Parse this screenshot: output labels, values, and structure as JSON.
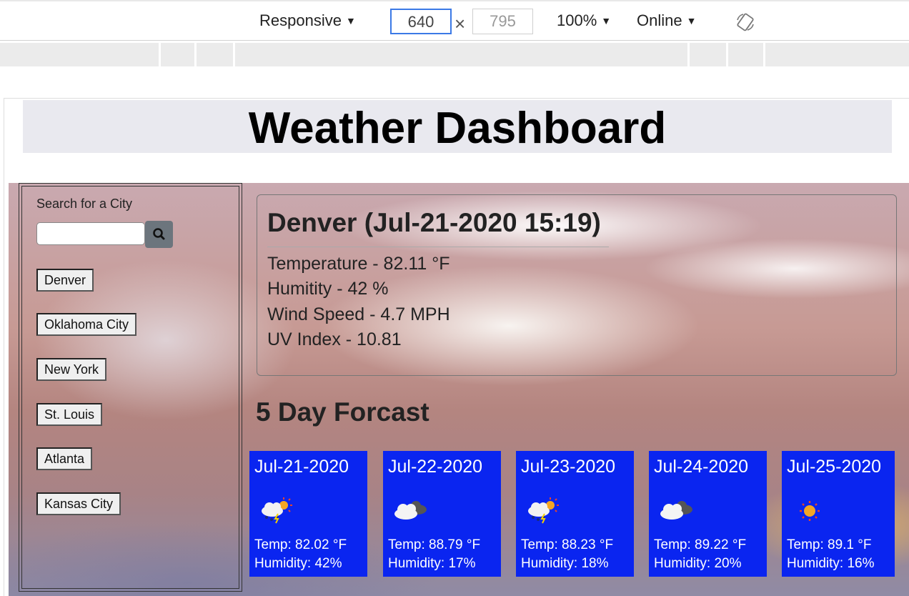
{
  "toolbar": {
    "device": "Responsive",
    "width": "640",
    "height": "795",
    "zoom": "100%",
    "network": "Online"
  },
  "page": {
    "title": "Weather Dashboard"
  },
  "sidebar": {
    "search_label": "Search for a City",
    "search_value": "",
    "cities": [
      "Denver",
      "Oklahoma City",
      "New York",
      "St. Louis",
      "Atlanta",
      "Kansas City"
    ]
  },
  "current": {
    "title": "Denver (Jul-21-2020 15:19)",
    "temperature": "Temperature - 82.11 °F",
    "humidity": "Humitity - 42 %",
    "wind": "Wind Speed - 4.7 MPH",
    "uv": "UV Index - 10.81"
  },
  "forecast": {
    "heading": "5 Day Forcast",
    "days": [
      {
        "date": "Jul-21-2020",
        "icon": "thunderstorm-sun-icon",
        "temp": "Temp: 82.02 °F",
        "humidity": "Humidity: 42%"
      },
      {
        "date": "Jul-22-2020",
        "icon": "broken-clouds-icon",
        "temp": "Temp: 88.79 °F",
        "humidity": "Humidity: 17%"
      },
      {
        "date": "Jul-23-2020",
        "icon": "thunderstorm-sun-icon",
        "temp": "Temp: 88.23 °F",
        "humidity": "Humidity: 18%"
      },
      {
        "date": "Jul-24-2020",
        "icon": "broken-clouds-icon",
        "temp": "Temp: 89.22 °F",
        "humidity": "Humidity: 20%"
      },
      {
        "date": "Jul-25-2020",
        "icon": "clear-sun-icon",
        "temp": "Temp: 89.1 °F",
        "humidity": "Humidity: 16%"
      }
    ]
  },
  "colors": {
    "card_blue": "#0a25f0",
    "search_button": "#6c757d",
    "focus_blue": "#3b79e6"
  }
}
